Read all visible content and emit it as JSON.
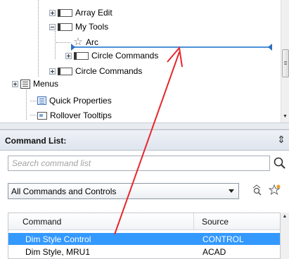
{
  "tree": {
    "items": [
      {
        "label": "Array Edit",
        "icon": "toolbar-icon",
        "expander": "plus"
      },
      {
        "label": "My Tools",
        "icon": "toolbar-icon",
        "expander": "minus"
      },
      {
        "label": "Arc",
        "icon": "star-icon",
        "expander": "none"
      },
      {
        "label": "Circle Commands",
        "icon": "toolbar-icon",
        "expander": "plus"
      },
      {
        "label": "Circle Commands",
        "icon": "toolbar-icon",
        "expander": "plus"
      },
      {
        "label": "Menus",
        "icon": "menu-icon",
        "expander": "plus"
      },
      {
        "label": "Quick Properties",
        "icon": "properties-icon",
        "expander": "none"
      },
      {
        "label": "Rollover Tooltips",
        "icon": "tooltip-icon",
        "expander": "none"
      }
    ]
  },
  "command_list": {
    "title": "Command List:",
    "search_placeholder": "Search command list",
    "filter_selected": "All Commands and Controls",
    "columns": [
      "Command",
      "Source"
    ],
    "rows": [
      {
        "command": "Dim Style Control",
        "source": "CONTROL",
        "selected": true
      },
      {
        "command": "Dim Style, MRU1",
        "source": "ACAD",
        "selected": false
      }
    ]
  },
  "colors": {
    "selection": "#3399ff",
    "drop_indicator": "#4a90d9",
    "annotation_arrow": "#e8262b"
  }
}
